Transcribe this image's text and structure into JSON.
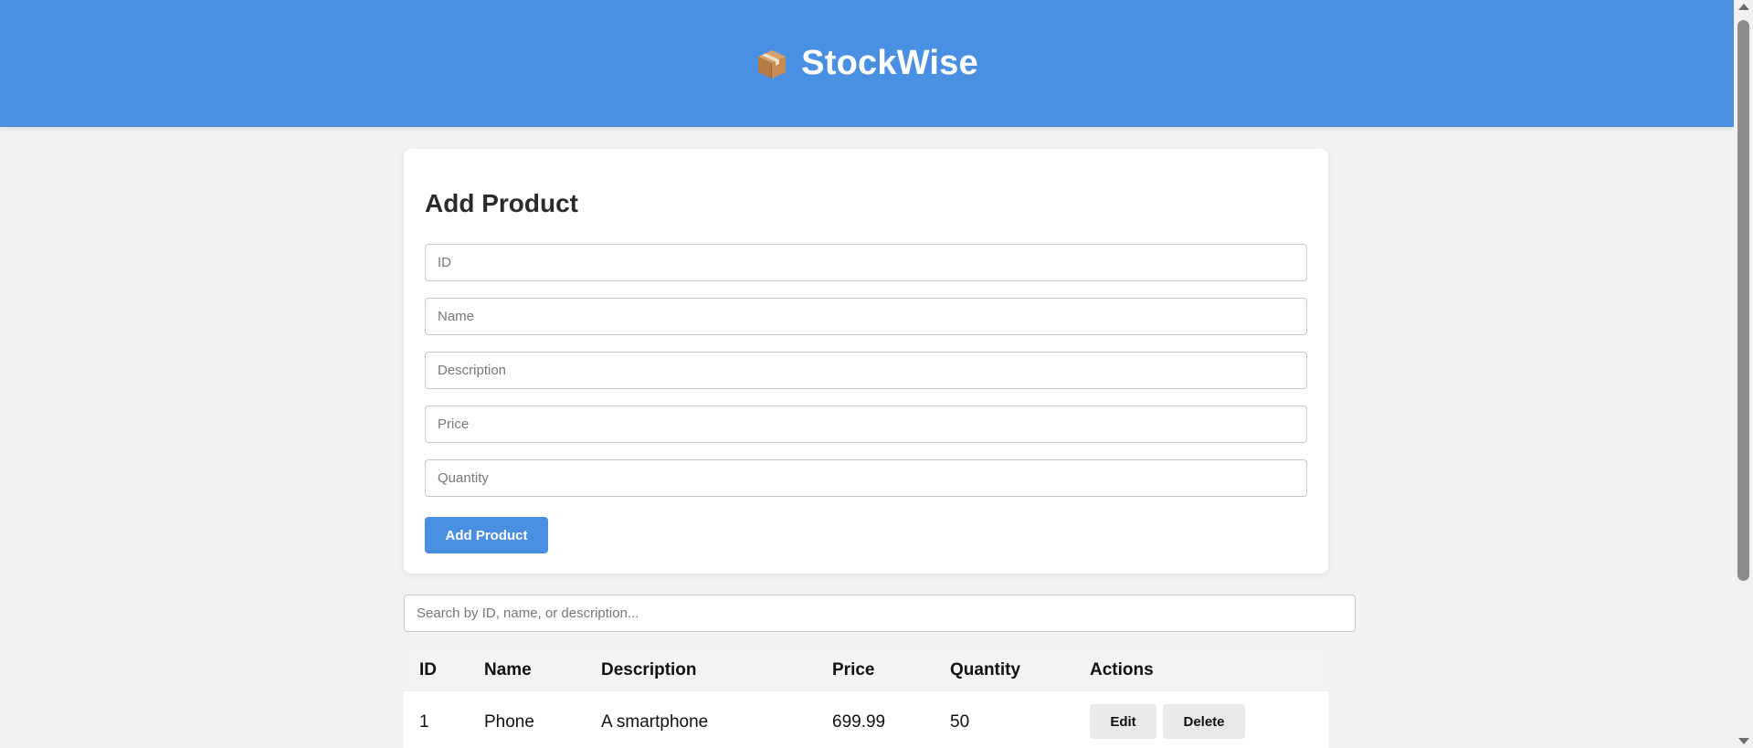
{
  "app": {
    "title": "StockWise",
    "icon": "package-box-icon",
    "accent_color": "#4a90e2"
  },
  "add_form": {
    "title": "Add Product",
    "fields": {
      "id_placeholder": "ID",
      "name_placeholder": "Name",
      "description_placeholder": "Description",
      "price_placeholder": "Price",
      "quantity_placeholder": "Quantity"
    },
    "submit_label": "Add Product"
  },
  "search": {
    "placeholder": "Search by ID, name, or description..."
  },
  "table": {
    "headers": [
      "ID",
      "Name",
      "Description",
      "Price",
      "Quantity",
      "Actions"
    ],
    "rows": [
      {
        "id": "1",
        "name": "Phone",
        "description": "A smartphone",
        "price": "699.99",
        "quantity": "50",
        "edit_label": "Edit",
        "delete_label": "Delete"
      }
    ]
  }
}
